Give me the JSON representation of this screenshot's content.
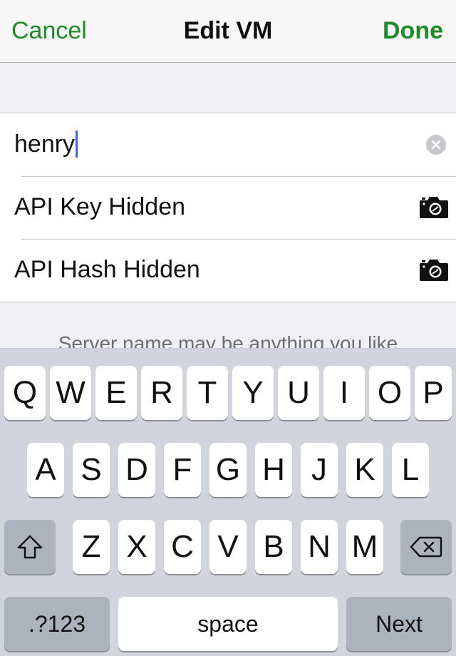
{
  "navbar": {
    "cancel_label": "Cancel",
    "title": "Edit VM",
    "done_label": "Done"
  },
  "form": {
    "server_name_value": "henry",
    "api_key_label": "API Key Hidden",
    "api_hash_label": "API Hash Hidden",
    "hint_text": "Server name may be anything you like"
  },
  "keyboard": {
    "row1": [
      "Q",
      "W",
      "E",
      "R",
      "T",
      "Y",
      "U",
      "I",
      "O",
      "P"
    ],
    "row2": [
      "A",
      "S",
      "D",
      "F",
      "G",
      "H",
      "J",
      "K",
      "L"
    ],
    "row3": [
      "Z",
      "X",
      "C",
      "V",
      "B",
      "N",
      "M"
    ],
    "numbers_label": ".?123",
    "space_label": "space",
    "next_label": "Next"
  },
  "colors": {
    "accent": "#1f8a2a",
    "caret": "#3b68dc",
    "keyboard_bg": "#d1d5db"
  },
  "icons": [
    "clear-icon",
    "camera-icon",
    "shift-icon",
    "backspace-icon"
  ]
}
